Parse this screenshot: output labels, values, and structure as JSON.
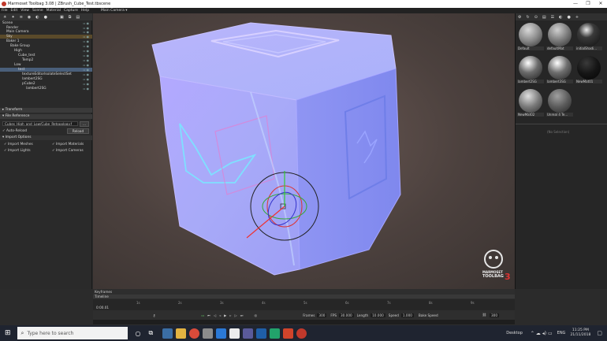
{
  "window": {
    "title": "Marmoset Toolbag 3.08 | ZBrush_Cube_Test.tbscene",
    "minimize": "—",
    "maximize": "❐",
    "close": "✕"
  },
  "menu": [
    "File",
    "Edit",
    "View",
    "Scene",
    "Material",
    "Capture",
    "Help"
  ],
  "viewport": {
    "camera_label": "Main Camera ▾"
  },
  "scene_tree": [
    {
      "label": "Scene",
      "indent": 0
    },
    {
      "label": "Render",
      "indent": 1
    },
    {
      "label": "Main Camera",
      "indent": 1
    },
    {
      "label": "Sky",
      "indent": 1
    },
    {
      "label": "Baker 1",
      "indent": 1
    },
    {
      "label": "Bake Group",
      "indent": 2
    },
    {
      "label": "High",
      "indent": 3
    },
    {
      "label": "Cube_test",
      "indent": 4
    },
    {
      "label": "Temp2",
      "indent": 5
    },
    {
      "label": "Low",
      "indent": 3
    },
    {
      "label": "test",
      "indent": 4,
      "selected": true
    },
    {
      "label": "textureEditorIsolateSelectSet",
      "indent": 5
    },
    {
      "label": "lambert2SG",
      "indent": 5
    },
    {
      "label": "pCube2",
      "indent": 5
    },
    {
      "label": "lambert2SG",
      "indent": 6
    }
  ],
  "sections": {
    "transform": "▸ Transform",
    "file_reference": "▾ File Reference",
    "import_options": "▾ Import Options"
  },
  "file_reference": {
    "path": "Cubes_High_and_Low/Cube_Retopology.f",
    "browse": "...",
    "auto_reload": "✓ Auto-Reload",
    "reload": "Reload"
  },
  "import_options": {
    "import_meshes": "✓ Import Meshes",
    "import_materials": "✓ Import Materials",
    "import_lights": "✓ Import Lights",
    "import_cameras": "✓ Import Cameras"
  },
  "materials": [
    {
      "name": "Default",
      "color": "#8a8a8a"
    },
    {
      "name": "defaultMat",
      "color": "#7a7a7a"
    },
    {
      "name": "initialShadi...",
      "color": "#3a3a3a"
    },
    {
      "name": "lambert2SG",
      "color": "#6a6a6a"
    },
    {
      "name": "lambert3SG",
      "color": "#6e6e6e"
    },
    {
      "name": "NewMat01",
      "color": "#151515"
    },
    {
      "name": "NewMat02",
      "color": "#7a7a7a"
    },
    {
      "name": "Unreal 4 Te...",
      "color": "#5c5c5c"
    }
  ],
  "right_panel": {
    "no_selection": "(No Selection)"
  },
  "timeline": {
    "keyframes_label": "Keyframes",
    "timeline_label": "Timeline",
    "current_frame": "0:00.01",
    "ticks": [
      "1s",
      "2s",
      "3s",
      "4s",
      "5s",
      "6s",
      "7s",
      "8s",
      "9s"
    ],
    "frames_label": "Frames",
    "frames_value": "300",
    "fps_label": "FPS",
    "fps_value": "30.000",
    "length_label": "Length",
    "length_value": "10.000",
    "speed_label": "Speed",
    "speed_value": "1.000",
    "bake_speed": "Bake Speed",
    "end_value": "300"
  },
  "logo": {
    "line1": "MARMOSET",
    "line2": "TOOLBAG",
    "line3": "3"
  },
  "taskbar": {
    "search_placeholder": "Type here to search",
    "desktop": "Desktop",
    "lang": "ENG",
    "time": "11:25 PM",
    "date": "21/11/2018"
  },
  "colors": {
    "accent_red": "#c0392b",
    "selection": "#4a5f7a",
    "normal_map_base": "#8080ff"
  }
}
